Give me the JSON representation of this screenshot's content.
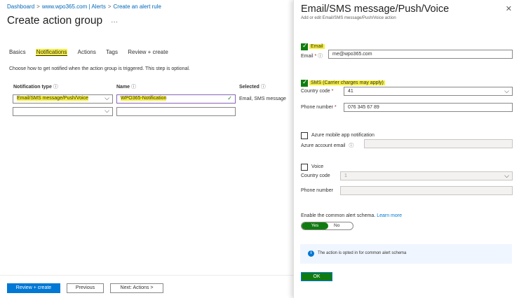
{
  "breadcrumb": [
    "Dashboard",
    "www.wpo365.com | Alerts",
    "Create an alert rule"
  ],
  "page_title": "Create action group",
  "more": "···",
  "tabs": [
    "Basics",
    "Notifications",
    "Actions",
    "Tags",
    "Review + create"
  ],
  "description": "Choose how to get notified when the action group is triggered. This step is optional.",
  "table": {
    "headers": [
      "Notification type",
      "Name",
      "Selected"
    ],
    "row1": {
      "type": "Email/SMS message/Push/Voice",
      "name": "WPO365-Notification",
      "selected": "Email, SMS message"
    }
  },
  "footer": {
    "review": "Review + create",
    "previous": "Previous",
    "next": "Next: Actions >"
  },
  "panel": {
    "title": "Email/SMS message/Push/Voice",
    "subtitle": "Add or edit Email/SMS message/Push/Voice action",
    "email": {
      "checkbox": "Email",
      "label": "Email",
      "value": "me@wpo365.com",
      "checked": true
    },
    "sms": {
      "checkbox": "SMS (Carrier charges may apply)",
      "country_label": "Country code",
      "country_value": "41",
      "phone_label": "Phone number",
      "phone_value": "076 345 67 89",
      "checked": true
    },
    "push": {
      "checkbox": "Azure mobile app notification",
      "label": "Azure account email",
      "checked": false
    },
    "voice": {
      "checkbox": "Voice",
      "country_label": "Country code",
      "country_value": "1",
      "phone_label": "Phone number",
      "checked": false
    },
    "schema": {
      "label": "Enable the common alert schema.",
      "link": "Learn more",
      "yes": "Yes",
      "no": "No"
    },
    "info": "The action is opted in for common alert schema",
    "ok": "OK"
  },
  "colors": {
    "accent": "#0078d4",
    "toggle_on": "#107c10",
    "highlight": "#f6ef3a"
  }
}
